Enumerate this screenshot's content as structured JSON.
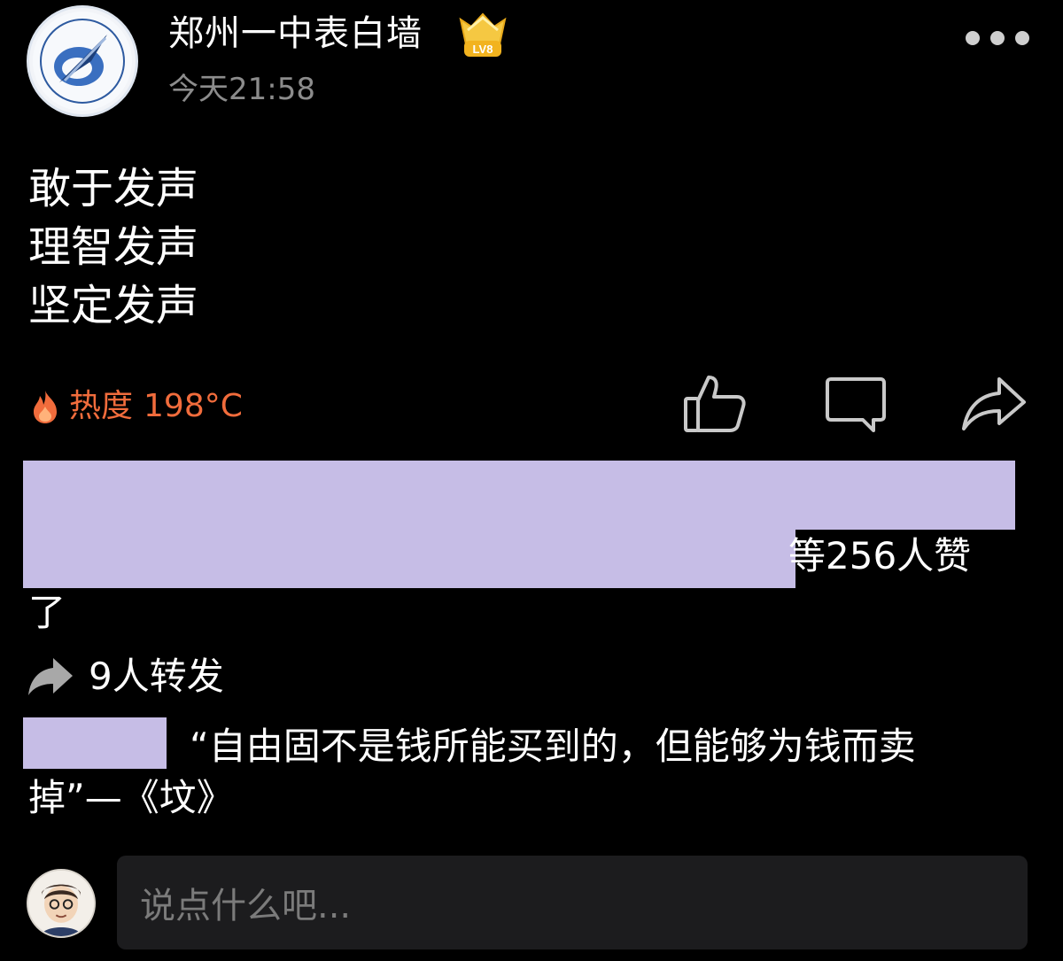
{
  "author": {
    "name": "郑州一中表白墙",
    "level": "LV8",
    "time": "今天21:58",
    "avatar_icon": "school-logo-icon"
  },
  "post": {
    "lines": [
      "敢于发声",
      "理智发声",
      "坚定发声"
    ]
  },
  "heat": {
    "label": "热度",
    "value": "198°C",
    "color": "#f16c3c"
  },
  "actions": {
    "like_icon": "thumbs-up-icon",
    "comment_icon": "comment-icon",
    "share_icon": "share-icon"
  },
  "likes": {
    "text": "等256人赞",
    "tail": "了"
  },
  "forwards": {
    "text": "9人转发"
  },
  "comment": {
    "line1": "“自由固不是钱所能买到的，但能够为钱而卖",
    "line2": "掉”—《坟》"
  },
  "input": {
    "placeholder": "说点什么吧..."
  },
  "colors": {
    "background": "#000000",
    "redaction": "#c6bde6",
    "muted_text": "#8c8c8c",
    "input_bg": "#1c1c1e"
  }
}
